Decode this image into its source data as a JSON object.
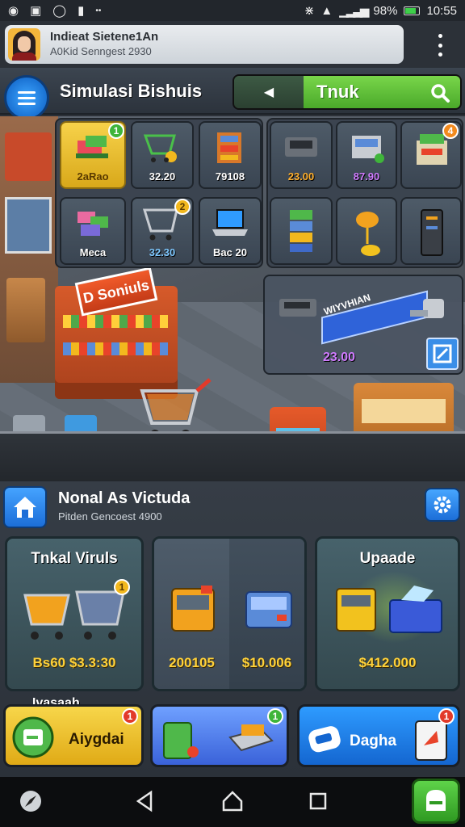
{
  "status_bar": {
    "battery": "98%",
    "time": "10:55"
  },
  "notification": {
    "title": "Indieat Sietene1An",
    "subtitle": "A0Kid Senngest 2930"
  },
  "app_bar": {
    "title": "Simulasi Bishuis",
    "tab_label": "Tnuk"
  },
  "shop_grid": [
    {
      "price": "2aRao",
      "badge": "1"
    },
    {
      "price": "32.20"
    },
    {
      "price": "79108"
    },
    {
      "price": "23.00",
      "badge": "4"
    },
    {
      "price": "87.90"
    },
    {
      "price": "Meca"
    },
    {
      "price": "32.30",
      "badge": "2"
    },
    {
      "price": "Bac 20"
    }
  ],
  "wide_item": {
    "price": "23.00",
    "banner": "WIYVHIAN"
  },
  "scene": {
    "sign": "D Soniuls"
  },
  "hud": {
    "title": "Nonal As Victuda",
    "subtitle": "Pitden Gencoest 4900"
  },
  "cards": [
    {
      "title": "Tnkal Viruls",
      "value": "Bs60 $3.3:30",
      "badge": "1"
    },
    {
      "value_left": "200105",
      "value_right": "$10.006"
    },
    {
      "title": "Upaade",
      "value": "$412.000"
    }
  ],
  "actions": {
    "section_label": "Ivasaah",
    "left_label": "Aiygdai",
    "left_badge": "1",
    "mid_badge": "1",
    "right_label": "Dagha",
    "right_badge": "1"
  },
  "colors": {
    "accent_green": "#4aa92a",
    "accent_blue": "#1c6ed8",
    "gold": "#ffd23a"
  }
}
